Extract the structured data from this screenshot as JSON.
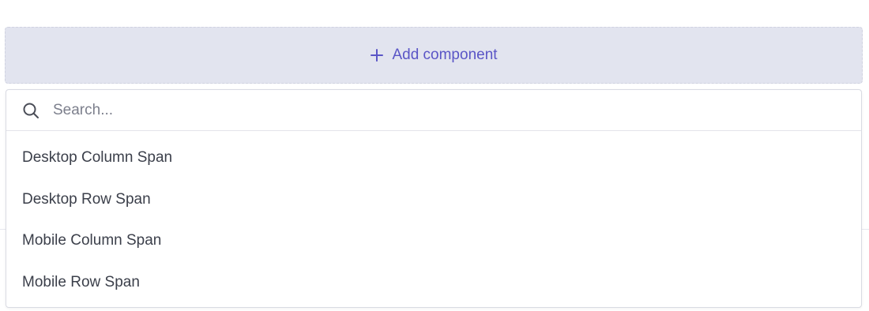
{
  "add_component": {
    "label": "Add component",
    "icon": "plus-icon",
    "accent": "#5a55c6",
    "background": "#e2e4ef"
  },
  "dropdown": {
    "search": {
      "placeholder": "Search...",
      "value": "",
      "icon": "search-icon"
    },
    "options": [
      {
        "label": "Desktop Column Span"
      },
      {
        "label": "Desktop Row Span"
      },
      {
        "label": "Mobile Column Span"
      },
      {
        "label": "Mobile Row Span"
      }
    ]
  }
}
